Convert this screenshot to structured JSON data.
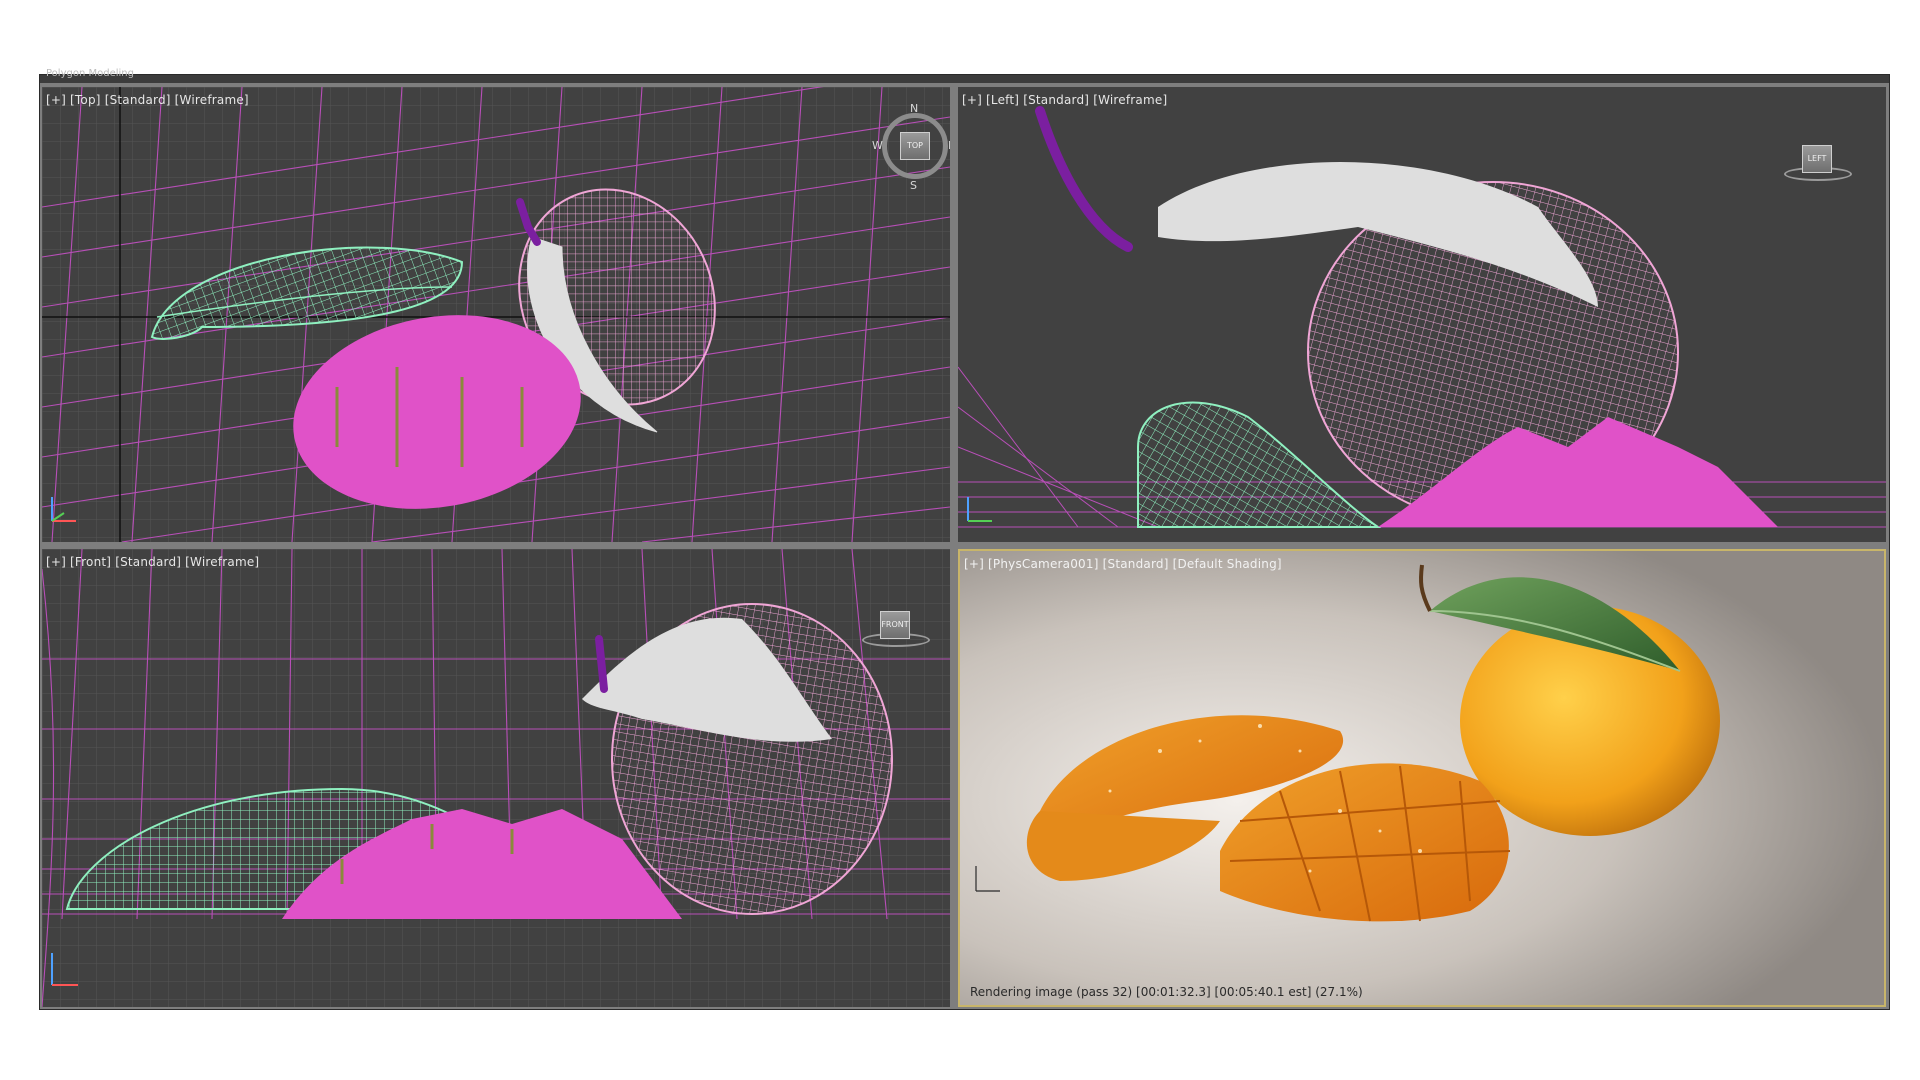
{
  "app": {
    "top_strip_label": "Polygon Modeling"
  },
  "viewports": {
    "top": {
      "labels": [
        "[+]",
        "[Top]",
        "[Standard]",
        "[Wireframe]"
      ],
      "navcube": "TOP",
      "compass": {
        "n": "N",
        "s": "S",
        "e": "E",
        "w": "W"
      }
    },
    "left": {
      "labels": [
        "[+]",
        "[Left]",
        "[Standard]",
        "[Wireframe]"
      ],
      "navcube": "LEFT"
    },
    "front": {
      "labels": [
        "[+]",
        "[Front]",
        "[Standard]",
        "[Wireframe]"
      ],
      "navcube": "FRONT"
    },
    "camera": {
      "labels": [
        "[+]",
        "[PhysCamera001]",
        "[Standard]",
        "[Default Shading]"
      ],
      "status": "Rendering image (pass 32) [00:01:32.3] [00:05:40.1 est]    (27.1%)",
      "render_progress_percent": 27.1
    }
  },
  "colors": {
    "viewport_bg": "#414141",
    "grid": "#b84fb8",
    "grid_fine": "#5a5a5a",
    "mango_wire": "#f0a6d6",
    "slice_wire": "#8ff0c0",
    "cubed_fill": "#e052c8",
    "leaf_fill": "#dedede",
    "stem": "#7b1fa0",
    "active_border": "#c8b56a"
  },
  "icons": {
    "navcube": "view-cube-icon",
    "compass": "compass-ring-icon",
    "axis": "axis-tripod-icon"
  }
}
